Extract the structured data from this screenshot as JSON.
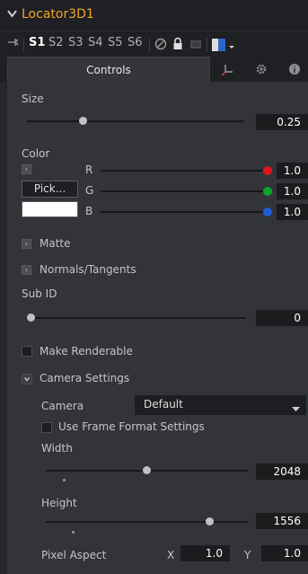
{
  "header": {
    "node_name": "Locator3D1"
  },
  "versions": {
    "items": [
      "S1",
      "S2",
      "S3",
      "S4",
      "S5",
      "S6"
    ],
    "active": "S1"
  },
  "tabs": {
    "controls_label": "Controls"
  },
  "size": {
    "label": "Size",
    "value": "0.25"
  },
  "color": {
    "label": "Color",
    "pick_label": "Pick...",
    "swatch_hex": "#ffffff",
    "r_label": "R",
    "r_value": "1.0",
    "r_dot": "#e1141d",
    "g_label": "G",
    "g_value": "1.0",
    "g_dot": "#10a52e",
    "b_label": "B",
    "b_value": "1.0",
    "b_dot": "#1f5ed4"
  },
  "sections": {
    "matte": "Matte",
    "normals": "Normals/Tangents",
    "camera_settings": "Camera Settings"
  },
  "sub_id": {
    "label": "Sub ID",
    "value": "0"
  },
  "make_renderable": {
    "label": "Make Renderable",
    "checked": false
  },
  "camera": {
    "label": "Camera",
    "selected": "Default",
    "use_frame_format_label": "Use Frame Format Settings",
    "width_label": "Width",
    "width_value": "2048",
    "height_label": "Height",
    "height_value": "1556",
    "pixel_aspect_label": "Pixel Aspect",
    "pixel_aspect_x_label": "X",
    "pixel_aspect_x_value": "1.0",
    "pixel_aspect_y_label": "Y",
    "pixel_aspect_y_value": "1.0"
  },
  "colors": {
    "accent_title": "#f0a52a",
    "panel_bg": "#32343a",
    "field_bg": "#1b1c1e"
  }
}
